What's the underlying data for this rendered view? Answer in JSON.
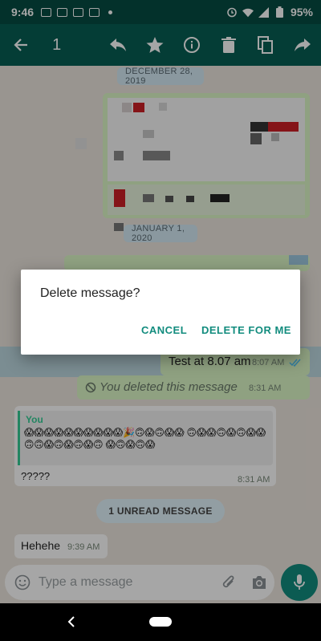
{
  "status_bar": {
    "time": "9:46",
    "battery": "95%"
  },
  "action_bar": {
    "selected_count": "1"
  },
  "chat": {
    "date_1": "DECEMBER 28, 2019",
    "date_2": "JANUARY 1, 2020",
    "msg_test": {
      "text": "Test at 8.07 am",
      "time": "8:07 AM"
    },
    "msg_deleted": {
      "text": "You deleted this message",
      "time": "8:31 AM"
    },
    "msg_reply": {
      "quote_author": "You",
      "quote_emojis": "😱😱😱😱😱😱😱😱😱😱🎉🙃😱🙃😱😱 🙃😱😱🙃😱🙃😱😱🙃🙃😱🙃😱🙃😱🙃 😱🙃😱🙃😱",
      "text": "?????",
      "time": "8:31 AM"
    },
    "unread": "1 UNREAD MESSAGE",
    "msg_hehehe": {
      "text": "Hehehe",
      "time": "9:39 AM"
    }
  },
  "dialog": {
    "title": "Delete message?",
    "cancel": "CANCEL",
    "delete": "DELETE FOR ME"
  },
  "input": {
    "placeholder": "Type a message"
  },
  "colors": {
    "header": "#075e54",
    "status": "#064c43",
    "accent": "#128c7e",
    "bubble_out": "#dcf8c6"
  }
}
